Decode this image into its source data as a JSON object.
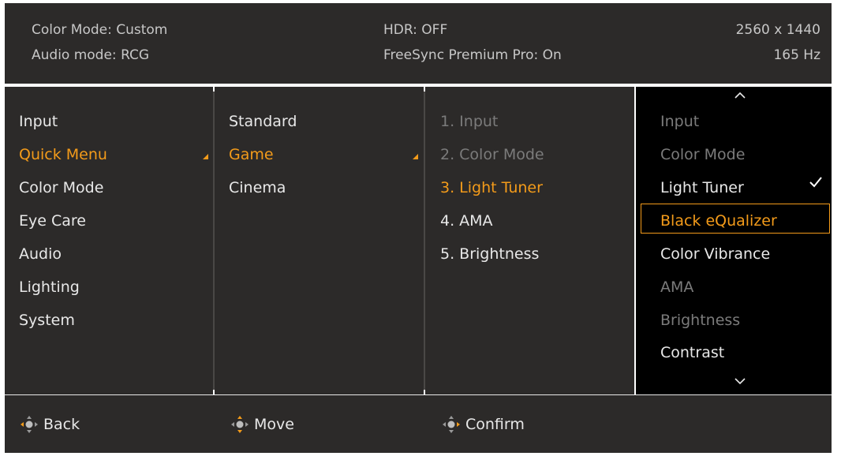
{
  "status": {
    "color_mode": "Color Mode: Custom",
    "audio_mode": "Audio mode: RCG",
    "hdr": "HDR: OFF",
    "freesync": "FreeSync Premium Pro: On",
    "resolution": "2560 x 1440",
    "refresh_rate": "165 Hz"
  },
  "main_menu": {
    "items": [
      {
        "label": "Input"
      },
      {
        "label": "Quick Menu",
        "state": "selected"
      },
      {
        "label": "Color Mode"
      },
      {
        "label": "Eye Care"
      },
      {
        "label": "Audio"
      },
      {
        "label": "Lighting"
      },
      {
        "label": "System"
      }
    ]
  },
  "submenu": {
    "items": [
      {
        "label": "Standard"
      },
      {
        "label": "Game",
        "state": "selected"
      },
      {
        "label": "Cinema"
      }
    ]
  },
  "quick_slots": {
    "items": [
      {
        "label": "1. Input",
        "state": "disabled"
      },
      {
        "label": "2. Color Mode",
        "state": "disabled"
      },
      {
        "label": "3. Light Tuner",
        "state": "selected"
      },
      {
        "label": "4. AMA"
      },
      {
        "label": "5. Brightness"
      }
    ]
  },
  "options": {
    "items": [
      {
        "label": "Input",
        "state": "disabled"
      },
      {
        "label": "Color Mode",
        "state": "disabled"
      },
      {
        "label": "Light Tuner",
        "state": "checked"
      },
      {
        "label": "Black eQualizer",
        "state": "highlighted"
      },
      {
        "label": "Color Vibrance"
      },
      {
        "label": "AMA",
        "state": "disabled"
      },
      {
        "label": "Brightness",
        "state": "disabled"
      },
      {
        "label": "Contrast"
      }
    ],
    "scroll_up_icon": "chevron-up-icon",
    "scroll_down_icon": "chevron-down-icon",
    "check_icon": "checkmark-icon"
  },
  "footer": {
    "back": "Back",
    "move": "Move",
    "confirm": "Confirm",
    "nav_icon": "five-way-joystick-icon"
  },
  "colors": {
    "accent": "#f39b1a",
    "panel": "#2c2a29",
    "option_panel": "#000000",
    "text": "#e8e8e8",
    "disabled_text": "#7b7b7b"
  }
}
